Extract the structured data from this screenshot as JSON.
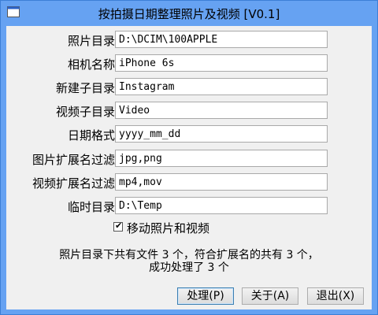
{
  "window": {
    "title": "按拍摄日期整理照片及视频 [V0.1]"
  },
  "fields": [
    {
      "label": "照片目录",
      "value": "D:\\DCIM\\100APPLE"
    },
    {
      "label": "相机名称",
      "value": "iPhone 6s"
    },
    {
      "label": "新建子目录",
      "value": "Instagram"
    },
    {
      "label": "视频子目录",
      "value": "Video"
    },
    {
      "label": "日期格式",
      "value": "yyyy_mm_dd"
    },
    {
      "label": "图片扩展名过滤",
      "value": "jpg,png"
    },
    {
      "label": "视频扩展名过滤",
      "value": "mp4,mov"
    },
    {
      "label": "临时目录",
      "value": "D:\\Temp"
    }
  ],
  "move_option": {
    "label": "移动照片和视频",
    "checked": true
  },
  "summary": {
    "line1": "照片目录下共有文件 3 个，符合扩展名的共有 3 个，",
    "line2": "成功处理了 3 个"
  },
  "buttons": {
    "process": "处理(P)",
    "about": "关于(A)",
    "exit": "退出(X)"
  },
  "colors": {
    "titlebar": "#66a2f2",
    "client": "#f0f0f0"
  }
}
